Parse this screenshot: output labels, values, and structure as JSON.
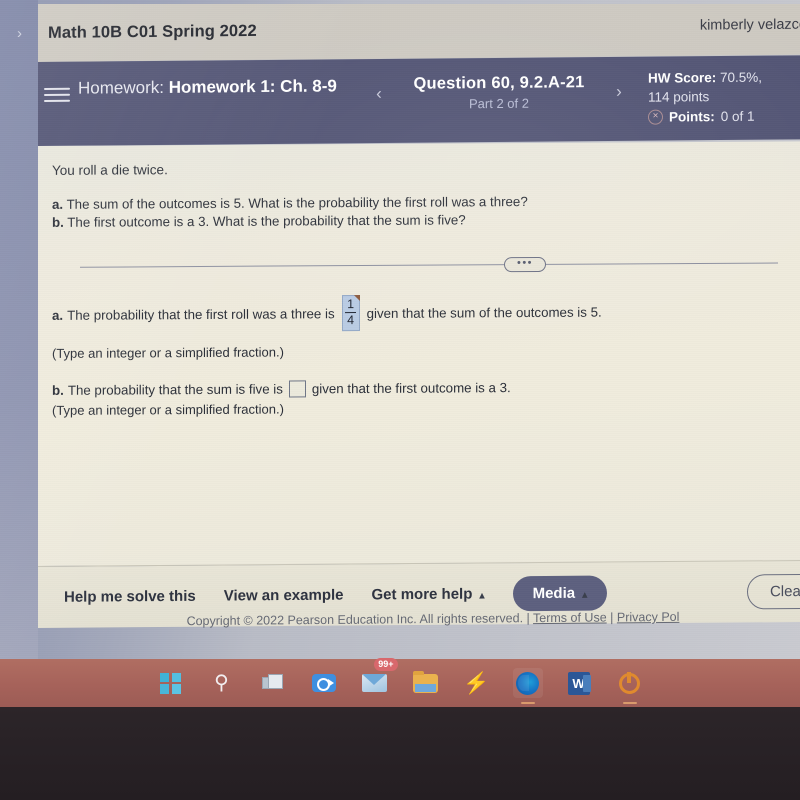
{
  "left_rail": {
    "expand_chevron": "›"
  },
  "course_bar": {
    "title": "Math 10B C01 Spring 2022",
    "user": "kimberly velazco"
  },
  "hw_bar": {
    "menu_icon": "hamburger-icon",
    "label": "Homework:",
    "assignment": "Homework 1: Ch. 8-9",
    "prev_arrow": "‹",
    "next_arrow": "›",
    "question_title": "Question 60, 9.2.A-21",
    "part": "Part 2 of 2",
    "hw_score_label": "HW Score:",
    "hw_score_value": "70.5%,",
    "points_total": "114 points",
    "points_status_icon": "×",
    "points_label": "Points:",
    "points_value": "0 of 1"
  },
  "content": {
    "prompt": "You roll a die twice.",
    "sub_a_marker": "a.",
    "sub_a_text": "The sum of the outcomes is 5. What is the probability the first roll was a three?",
    "sub_b_marker": "b.",
    "sub_b_text": "The first outcome is a 3. What is the probability that the sum is five?",
    "divider_dots": "•••",
    "answer_a": {
      "marker": "a.",
      "lead": "The probability that the first roll was a three is",
      "numerator": "1",
      "denominator": "4",
      "tail": "given that the sum of the outcomes is 5.",
      "note": "(Type an integer or a simplified fraction.)"
    },
    "answer_b": {
      "marker": "b.",
      "lead": "The probability that the sum is five is",
      "value": "",
      "tail": "given that the first outcome is a 3.",
      "note": "(Type an integer or a simplified fraction.)"
    }
  },
  "actions": {
    "help_me_solve": "Help me solve this",
    "view_example": "View an example",
    "get_more_help": "Get more help",
    "get_more_help_caret": "▴",
    "media": "Media",
    "media_caret": "▴",
    "clear_all": "Clear all"
  },
  "footer": {
    "copyright": "Copyright © 2022 Pearson Education Inc. All rights reserved. |",
    "terms": "Terms of Use",
    "separator": "|",
    "privacy": "Privacy Pol"
  },
  "taskbar": {
    "items": [
      {
        "name": "start",
        "label": "Start"
      },
      {
        "name": "search",
        "label": "Search",
        "glyph": "⚲"
      },
      {
        "name": "task-view",
        "label": "Task View"
      },
      {
        "name": "zoom",
        "label": "Zoom"
      },
      {
        "name": "mail",
        "label": "Mail",
        "badge": "99+"
      },
      {
        "name": "file-explorer",
        "label": "File Explorer"
      },
      {
        "name": "lightning-app",
        "label": "App",
        "glyph": "⚡"
      },
      {
        "name": "edge",
        "label": "Microsoft Edge"
      },
      {
        "name": "word",
        "label": "Word",
        "glyph": "W"
      },
      {
        "name": "origin",
        "label": "Origin"
      }
    ]
  },
  "colors": {
    "toolbar": "#525474",
    "course_bar": "#cdc9c1",
    "content_bg": "#efebdc",
    "answer_fill": "#b9cbe4",
    "media_button": "#5d607f",
    "taskbar": "#a6625a",
    "badge": "#d8686c"
  }
}
